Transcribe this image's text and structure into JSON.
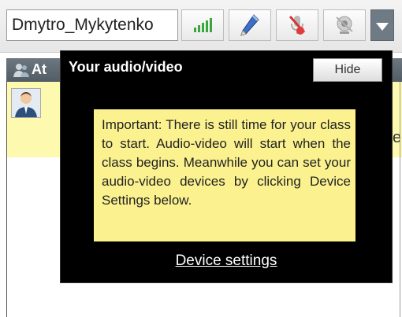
{
  "toolbar": {
    "username": "Dmytro_Mykytenko",
    "buttons": [
      "signal-strength-icon",
      "pencil-icon",
      "microphone-muted-icon",
      "webcam-off-icon"
    ]
  },
  "attendees": {
    "title_visible": "At"
  },
  "popup": {
    "title": "Your audio/video",
    "hide_label": "Hide",
    "notice": "Important: There is still time for your class to start. Audio-video will start when the class begins. Meanwhile you can set your audio-video devices by clicking Device Settings below.",
    "device_settings_link": "Device settings"
  },
  "colors": {
    "popup_bg": "#000000",
    "notice_bg": "#fbf28f",
    "attendee_row_bg": "#fdfab0",
    "header_bg": "#5f6a72"
  }
}
